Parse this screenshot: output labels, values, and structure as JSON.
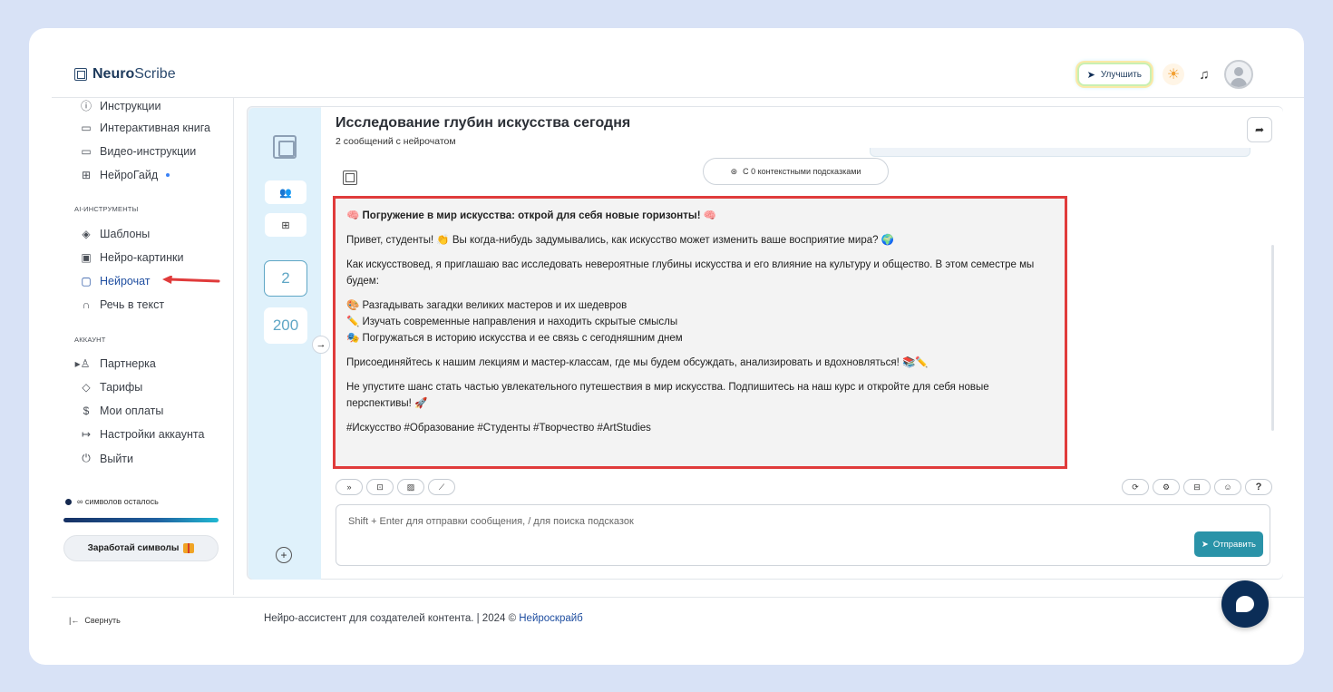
{
  "brand": {
    "prefix": "Neuro",
    "suffix": "Scribe"
  },
  "header": {
    "upgrade_label": "Улучшить"
  },
  "sidebar": {
    "items_top": [
      {
        "icon": "?",
        "label": "Инструкции"
      },
      {
        "icon": "▭",
        "label": "Интерактивная книга"
      },
      {
        "icon": "▷",
        "label": "Видео-инструкции"
      },
      {
        "icon": "⊞",
        "label": "НейроГайд"
      }
    ],
    "section_ai": "AI-ИНСТРУМЕНТЫ",
    "items_ai": [
      {
        "icon": "◈",
        "label": "Шаблоны"
      },
      {
        "icon": "▣",
        "label": "Нейро-картинки"
      },
      {
        "icon": "▢",
        "label": "Нейрочат"
      },
      {
        "icon": "∩",
        "label": "Речь в текст"
      }
    ],
    "section_account": "АККАУНТ",
    "items_account": [
      {
        "icon": "♙",
        "label": "Партнерка"
      },
      {
        "icon": "◇",
        "label": "Тарифы"
      },
      {
        "icon": "$",
        "label": "Мои оплаты"
      },
      {
        "icon": "↦",
        "label": "Настройки аккаунта"
      },
      {
        "icon": "⏻",
        "label": "Выйти"
      }
    ],
    "symbols_label": "∞ символов осталось",
    "earn_label": "Заработай символы",
    "collapse_label": "Свернуть"
  },
  "rail": {
    "count_selected": "2",
    "count_total": "200"
  },
  "chat": {
    "title": "Исследование глубин искусства сегодня",
    "subtitle": "2 сообщений с нейрочатом",
    "context_label": "С 0 контекстными подсказками",
    "message": {
      "heading": "Погружение в мир искусства: открой для себя новые горизонты!",
      "p1": "Привет, студенты! 👏 Вы когда-нибудь задумывались, как искусство может изменить ваше восприятие мира? 🌍",
      "p2": "Как искусствовед, я приглашаю вас исследовать невероятные глубины искусства и его влияние на культуру и общество. В этом семестре мы будем:",
      "b1": "🎨 Разгадывать загадки великих мастеров и их шедевров",
      "b2": "✏️ Изучать современные направления и находить скрытые смыслы",
      "b3": "🎭 Погружаться в историю искусства и ее связь с сегодняшним днем",
      "p3": "Присоединяйтесь к нашим лекциям и мастер-классам, где мы будем обсуждать, анализировать и вдохновляться! 📚✏️",
      "p4": "Не упустите шанс стать частью увлекательного путешествия в мир искусства. Подпишитесь на наш курс и откройте для себя новые перспективы! 🚀",
      "tags": "#Искусство #Образование #Студенты #Творчество #ArtStudies"
    },
    "input_placeholder": "Shift + Enter для отправки сообщения, / для поиска подсказок",
    "send_label": "Отправить"
  },
  "footer": {
    "text": "Нейро-ассистент для создателей контента.  | 2024 © ",
    "link": "Нейроскрайб"
  },
  "colors": {
    "accent": "#2a93a8",
    "highlight": "#e03b3b",
    "brand_dark": "#0b2d57"
  }
}
